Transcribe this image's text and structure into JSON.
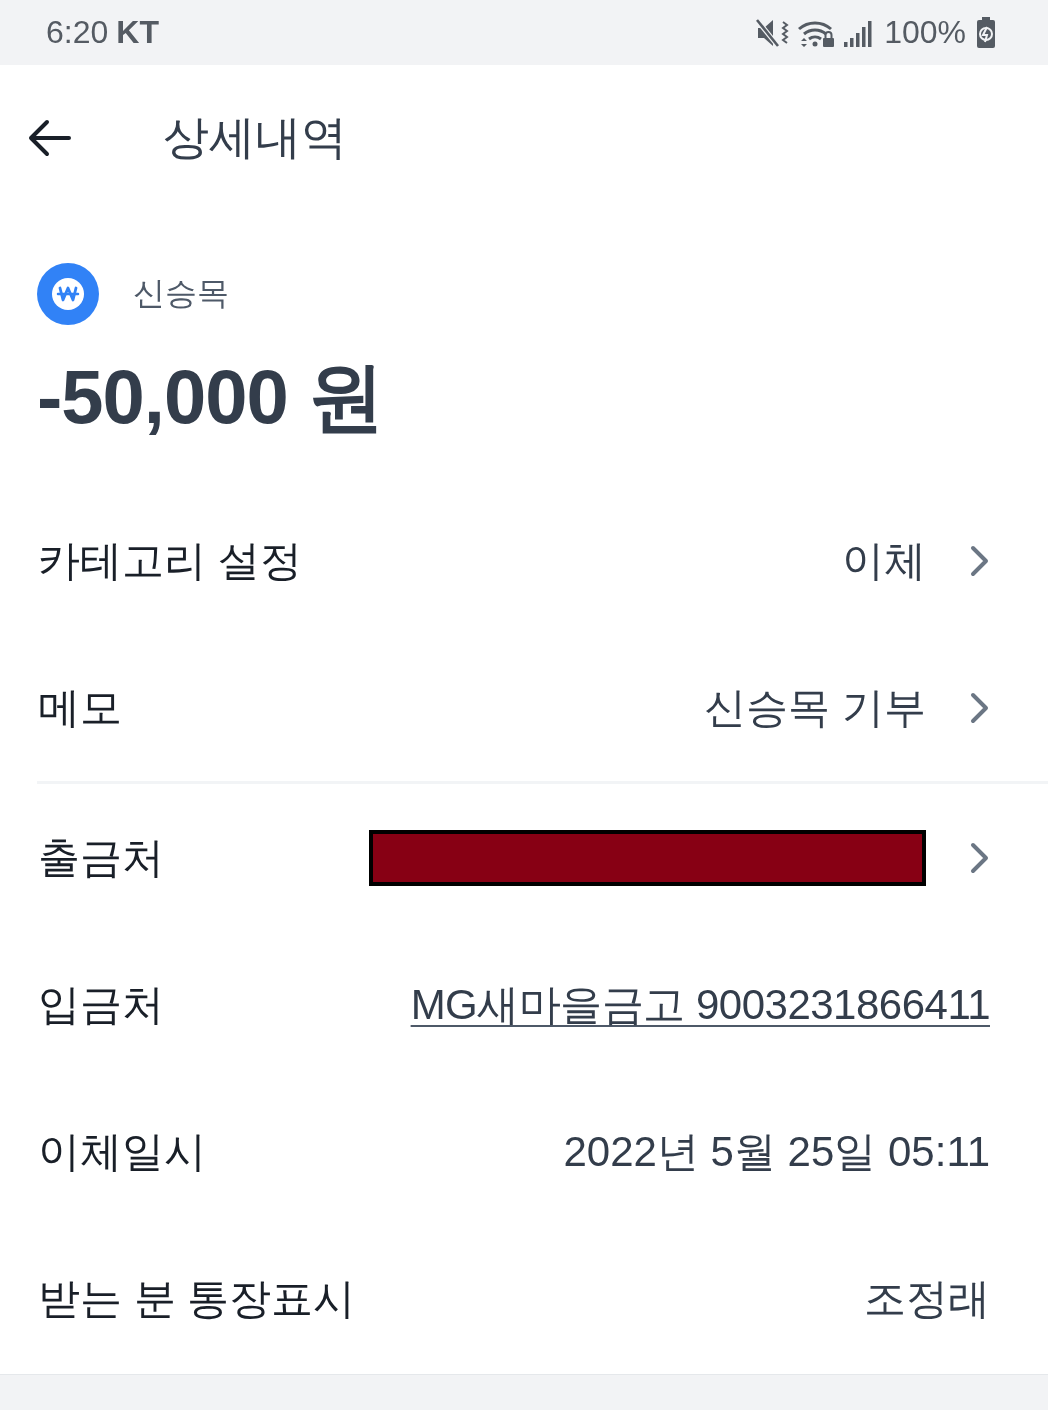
{
  "status_bar": {
    "time": "6:20",
    "carrier": "KT",
    "battery": "100%"
  },
  "header": {
    "title": "상세내역"
  },
  "summary": {
    "account_name": "신승목",
    "amount": "-50,000 원"
  },
  "sections": [
    {
      "rows": [
        {
          "label": "카테고리 설정",
          "kind": "nav",
          "value": "이체"
        },
        {
          "label": "메모",
          "kind": "nav",
          "value": "신승목 기부"
        }
      ]
    },
    {
      "rows": [
        {
          "label": "출금처",
          "kind": "redacted"
        },
        {
          "label": "입금처",
          "kind": "link",
          "value": "MG새마을금고 9003231866411"
        },
        {
          "label": "이체일시",
          "kind": "text",
          "value": "2022년 5월 25일 05:11"
        },
        {
          "label": "받는 분 통장표시",
          "kind": "text",
          "value": "조정래"
        }
      ]
    }
  ]
}
